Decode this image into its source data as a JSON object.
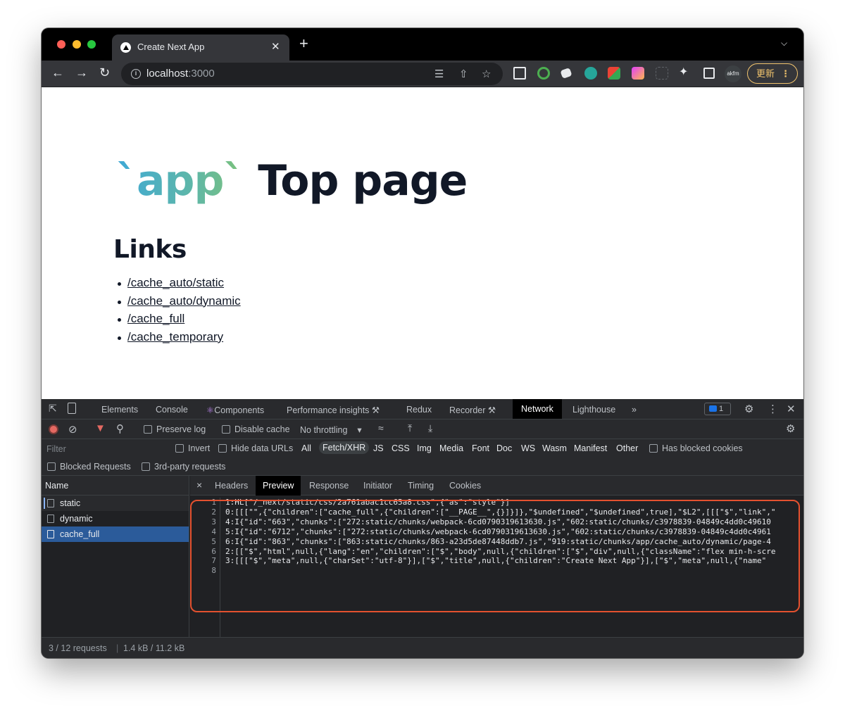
{
  "browser": {
    "tab_title": "Create Next App",
    "tab_close": "✕",
    "new_tab": "+",
    "url_host": "localhost",
    "url_port": ":3000",
    "update_label": "更新",
    "profile_label": "akfm"
  },
  "page": {
    "hero_code": "`app`",
    "hero_title": " Top page",
    "links_heading": "Links",
    "links": [
      "/cache_auto/static",
      "/cache_auto/dynamic",
      "/cache_full",
      "/cache_temporary"
    ]
  },
  "devtools": {
    "tabs": {
      "elements": "Elements",
      "console": "Console",
      "components": "Components",
      "performance": "Performance insights",
      "redux": "Redux",
      "recorder": "Recorder",
      "network": "Network",
      "lighthouse": "Lighthouse",
      "more": "»"
    },
    "issues_count": "1",
    "toolbar": {
      "preserve_log": "Preserve log",
      "disable_cache": "Disable cache",
      "throttling": "No throttling"
    },
    "filter": {
      "placeholder": "Filter",
      "invert": "Invert",
      "hide_data_urls": "Hide data URLs",
      "types": [
        "All",
        "Fetch/XHR",
        "JS",
        "CSS",
        "Img",
        "Media",
        "Font",
        "Doc",
        "WS",
        "Wasm",
        "Manifest",
        "Other"
      ],
      "has_blocked_cookies": "Has blocked cookies",
      "blocked_requests": "Blocked Requests",
      "third_party": "3rd-party requests"
    },
    "name_header": "Name",
    "requests": [
      "static",
      "dynamic",
      "cache_full"
    ],
    "detail_tabs": {
      "close": "×",
      "headers": "Headers",
      "preview": "Preview",
      "response": "Response",
      "initiator": "Initiator",
      "timing": "Timing",
      "cookies": "Cookies"
    },
    "code_lines": [
      "1:HL[\"/_next/static/css/2a761abac1cc65a8.css\",{\"as\":\"style\"}]",
      "0:[[[\"\",{\"children\":[\"cache_full\",{\"children\":[\"__PAGE__\",{}]}]},\"$undefined\",\"$undefined\",true],\"$L2\",[[[\"$\",\"link\",\"",
      "4:I{\"id\":\"663\",\"chunks\":[\"272:static/chunks/webpack-6cd0790319613630.js\",\"602:static/chunks/c3978839-04849c4dd0c49610",
      "5:I{\"id\":\"6712\",\"chunks\":[\"272:static/chunks/webpack-6cd0790319613630.js\",\"602:static/chunks/c3978839-04849c4dd0c4961",
      "6:I{\"id\":\"863\",\"chunks\":[\"863:static/chunks/863-a23d5de87448ddb7.js\",\"919:static/chunks/app/cache_auto/dynamic/page-4",
      "2:[[\"$\",\"html\",null,{\"lang\":\"en\",\"children\":[\"$\",\"body\",null,{\"children\":[\"$\",\"div\",null,{\"className\":\"flex min-h-scre",
      "3:[[[\"$\",\"meta\",null,{\"charSet\":\"utf-8\"}],[\"$\",\"title\",null,{\"children\":\"Create Next App\"}],[\"$\",\"meta\",null,{\"name\" ",
      ""
    ],
    "line_numbers": [
      "1",
      "2",
      "3",
      "4",
      "5",
      "6",
      "7",
      "8"
    ],
    "status": {
      "requests": "3 / 12 requests",
      "size": "1.4 kB / 11.2 kB"
    }
  }
}
